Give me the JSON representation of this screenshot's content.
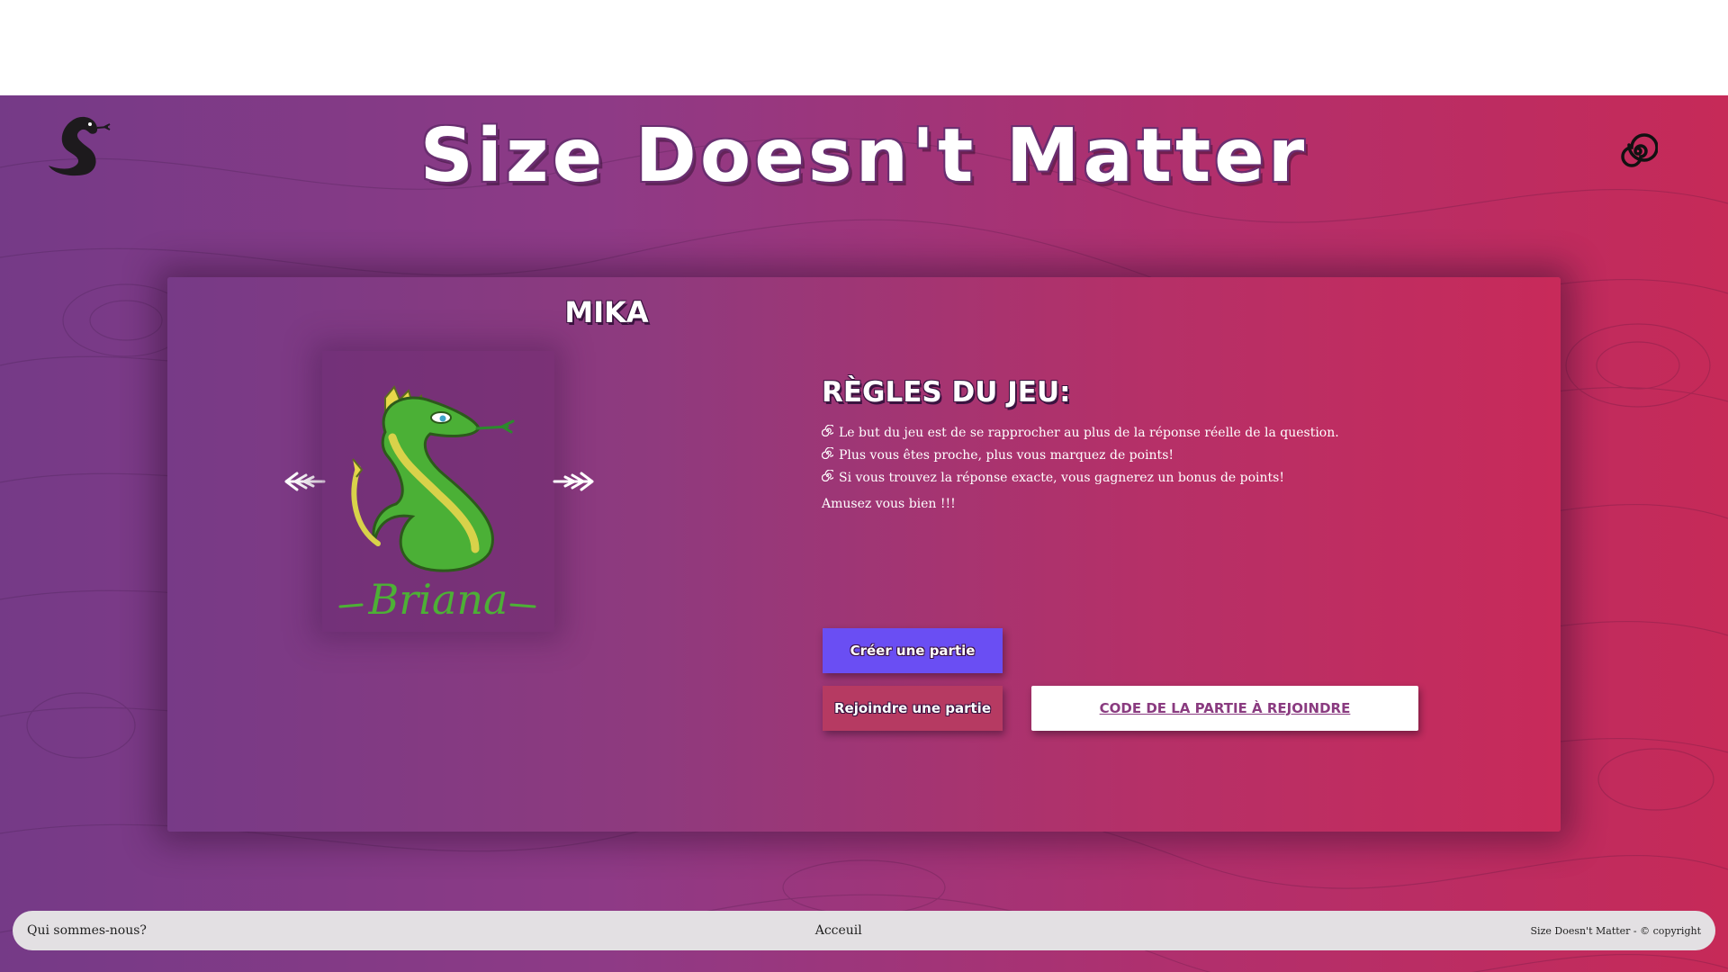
{
  "app": {
    "title": "Size Doesn't Matter"
  },
  "icons": {
    "logo": "snake-logo-icon",
    "menu": "spiral-icon",
    "prev": "arrow-left-icon",
    "next": "arrow-right-icon",
    "rule_bullet": "spiral-bullet-icon"
  },
  "player": {
    "name": "MIKA",
    "avatar_caption": "Briana"
  },
  "rules": {
    "title": "RÈGLES DU JEU:",
    "items": [
      "Le but du jeu est de se rapprocher au plus de la réponse réelle de la question.",
      "Plus vous êtes proche, plus vous marquez de points!",
      "Si vous trouvez la réponse exacte, vous gagnerez un bonus de points!"
    ],
    "outro": "Amusez vous bien !!!"
  },
  "actions": {
    "create_label": "Créer une partie",
    "join_label": "Rejoindre une partie",
    "code_placeholder": "CODE DE LA PARTIE À REJOINDRE"
  },
  "footer": {
    "about": "Qui sommes-nous?",
    "home": "Acceuil",
    "copyright": "Size Doesn't Matter - © copyright"
  },
  "colors": {
    "gradient_start": "#753a87",
    "gradient_end": "#c62a58",
    "create_button": "#6a4ef3",
    "join_button": "#b63a62",
    "footer_bg": "#e3e0e3"
  }
}
